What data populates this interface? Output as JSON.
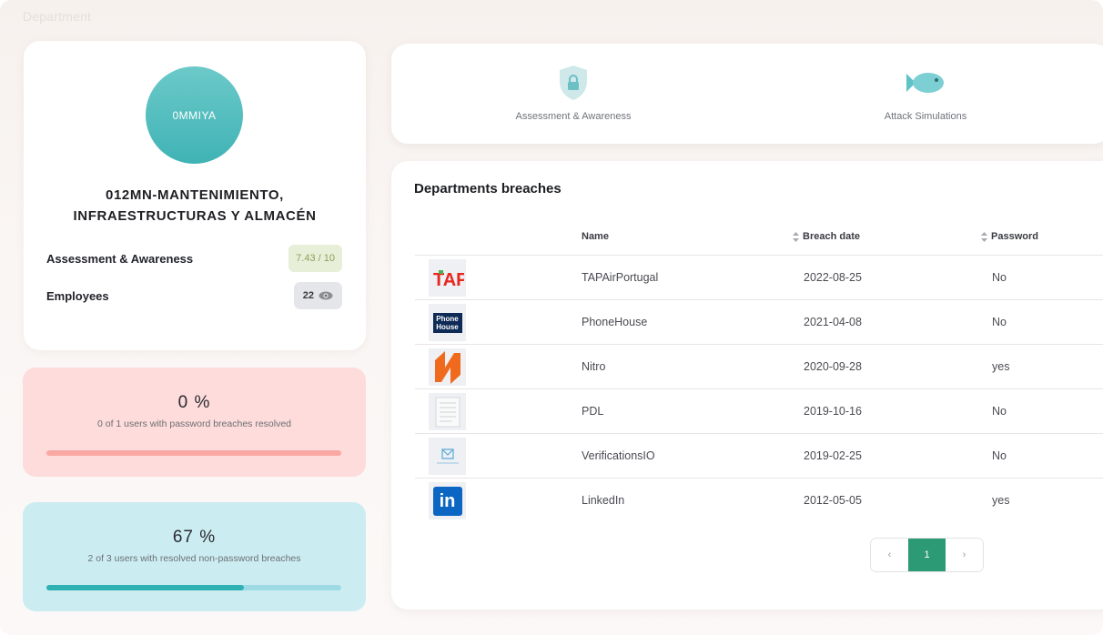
{
  "header": {
    "title": "Department"
  },
  "profile": {
    "avatar_text": "0MMIYA",
    "department_name_line1": "012MN-MANTENIMIENTO,",
    "department_name_line2": "INFRAESTRUCTURAS Y ALMACÉN",
    "stats": [
      {
        "label": "Assessment & Awareness",
        "value": "7.43 / 10"
      },
      {
        "label": "Employees",
        "value": "22"
      }
    ]
  },
  "progress": [
    {
      "percent_text": "0 %",
      "description": "0 of 1 users with password breaches resolved",
      "fraction": 0.0,
      "color": "#ee7d78"
    },
    {
      "percent_text": "67 %",
      "description": "2 of 3 users with resolved non-password breaches",
      "fraction": 0.67,
      "color": "#2fb0b3"
    }
  ],
  "tabs": [
    {
      "label": "Assessment & Awareness",
      "icon": "shield-lock-icon"
    },
    {
      "label": "Attack Simulations",
      "icon": "fish-icon"
    }
  ],
  "breaches": {
    "title": "Departments breaches",
    "columns": {
      "name": "Name",
      "date": "Breach date",
      "password": "Password"
    },
    "rows": [
      {
        "logo": "tap-logo",
        "logo_text": "TAP",
        "name": "TAPAirPortugal",
        "date": "2022-08-25",
        "password": "No"
      },
      {
        "logo": "phonehouse-logo",
        "logo_text": "Phone House",
        "name": "PhoneHouse",
        "date": "2021-04-08",
        "password": "No"
      },
      {
        "logo": "nitro-logo",
        "logo_text": "",
        "name": "Nitro",
        "date": "2020-09-28",
        "password": "yes"
      },
      {
        "logo": "pdl-logo",
        "logo_text": "",
        "name": "PDL",
        "date": "2019-10-16",
        "password": "No"
      },
      {
        "logo": "verifications-logo",
        "logo_text": "",
        "name": "VerificationsIO",
        "date": "2019-02-25",
        "password": "No"
      },
      {
        "logo": "linkedin-logo",
        "logo_text": "in",
        "name": "LinkedIn",
        "date": "2012-05-05",
        "password": "yes"
      }
    ]
  },
  "pagination": {
    "prev": "‹",
    "current": "1",
    "next": "›"
  },
  "colors": {
    "accent": "#2d9a76",
    "avatar": "#40b3b5"
  }
}
